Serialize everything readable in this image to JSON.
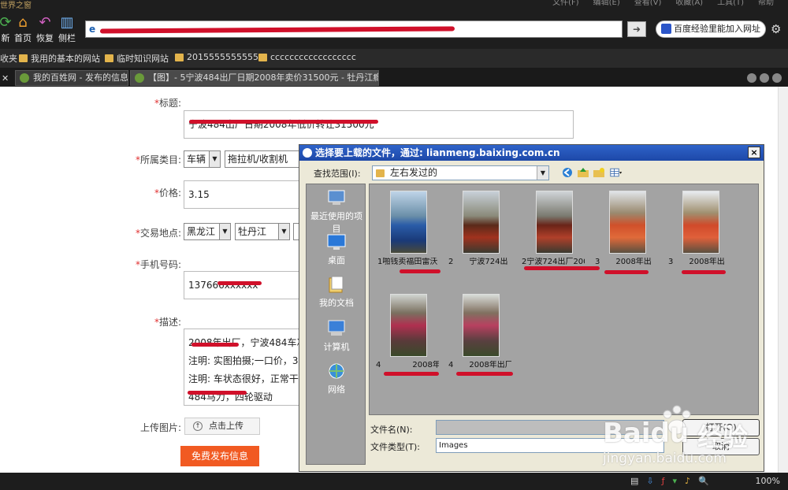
{
  "browser": {
    "app_title": "世界之窗",
    "menu": [
      "文件(F)",
      "编辑(E)",
      "查看(V)",
      "收藏(A)",
      "工具(T)",
      "帮助"
    ],
    "nav": {
      "refresh": "新",
      "home": "首页",
      "restore": "恢复",
      "fav_bar": "侧栏"
    },
    "search_button": "百度经验里能加入网址",
    "favorites": [
      "收夹",
      "我用的基本的网站",
      "临时知识网站",
      "2015555555555",
      "cccccccccccccccccc"
    ],
    "tabs": [
      "我的百姓网 - 发布的信息",
      "【图】- 5宁波484出厂日期2008年卖价31500元 - 牡丹江瘾..."
    ],
    "zoom": "100%"
  },
  "form": {
    "title_label": "标题:",
    "title_value": "宁波484出厂日期2008年低价转让31500元",
    "category_label": "所属类目:",
    "category_1": "车辆",
    "category_2": "拖拉机/收割机",
    "price_label": "价格:",
    "price_value": "3.15",
    "location_label": "交易地点:",
    "province": "黑龙江",
    "city": "牡丹江",
    "phone_label": "手机号码:",
    "phone_value": "137666xxxxxx",
    "desc_label": "描述:",
    "desc_lines": [
      "2008年出厂，宁波484车况",
      "注明: 实图拍摄;一口价，3",
      "注明: 车状态很好，正常干",
      "484马力，四轮驱动"
    ],
    "upload_label": "上传图片:",
    "upload_button": "点击上传",
    "publish_button": "免费发布信息",
    "star": "*"
  },
  "dialog": {
    "title": "选择要上载的文件，通过: lianmeng.baixing.com.cn",
    "close": "×",
    "look_in_label": "查找范围(I):",
    "look_in_value": "左右发过的",
    "places": [
      "最近使用的项目",
      "桌面",
      "我的文档",
      "计算机",
      "网络"
    ],
    "files": [
      "1啪钱卖福田雷沃",
      "2　　宁波724出",
      "2宁波724出厂2007",
      "3　　2008年出",
      "3　　2008年出",
      "4　　　　2008年",
      "4　　2008年出厂"
    ],
    "file_name_label": "文件名(N):",
    "file_name_value": "",
    "file_type_label": "文件类型(T):",
    "file_type_value": "Images",
    "open_button": "打开(O)",
    "cancel_button": "取消"
  },
  "watermark": {
    "brand": "Baidu",
    "cn": "经验",
    "url": "jingyan.baidu.com"
  },
  "colors": {
    "accent": "#f15a22",
    "redact": "#d0102a",
    "titlebar": "#2f63c9"
  }
}
